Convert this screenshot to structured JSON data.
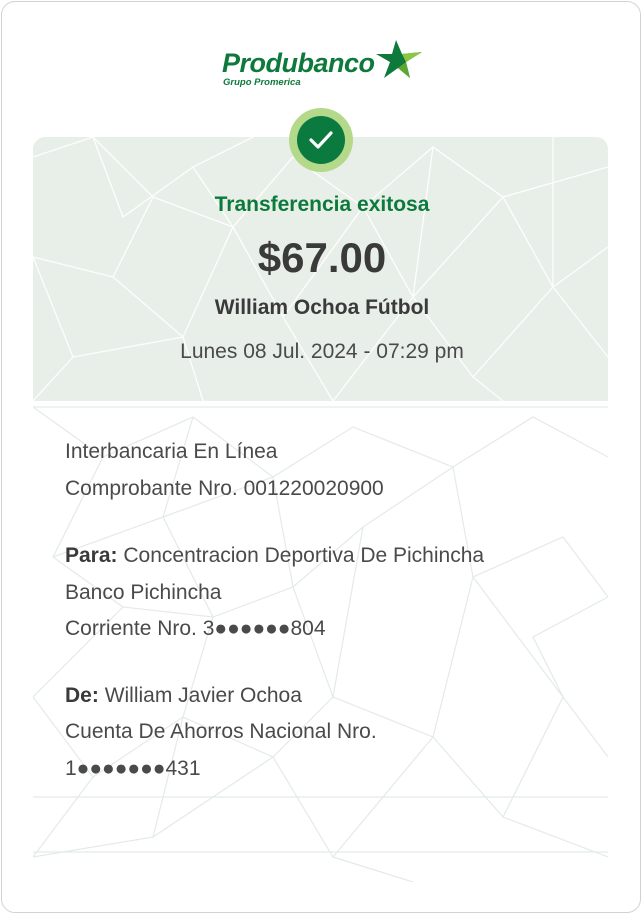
{
  "brand": {
    "name": "Produbanco",
    "tagline": "Grupo Promerica",
    "color_primary": "#0d7a3c",
    "color_accent": "#b5d98a"
  },
  "status": {
    "icon": "check-icon",
    "title": "Transferencia exitosa"
  },
  "transfer": {
    "amount": "$67.00",
    "recipient_name": "William Ochoa Fútbol",
    "datetime": "Lunes 08 Jul. 2024 - 07:29 pm"
  },
  "details": {
    "type": "Interbancaria En Línea",
    "voucher": "Comprobante Nro. 001220020900",
    "to_label": "Para:",
    "to_name": "Concentracion Deportiva De Pichincha",
    "to_bank": "Banco Pichincha",
    "to_account": "Corriente Nro. 3●●●●●●804",
    "from_label": "De:",
    "from_name": "William Javier Ochoa",
    "from_account_type": "Cuenta De Ahorros Nacional Nro.",
    "from_account_number": "1●●●●●●●431"
  }
}
